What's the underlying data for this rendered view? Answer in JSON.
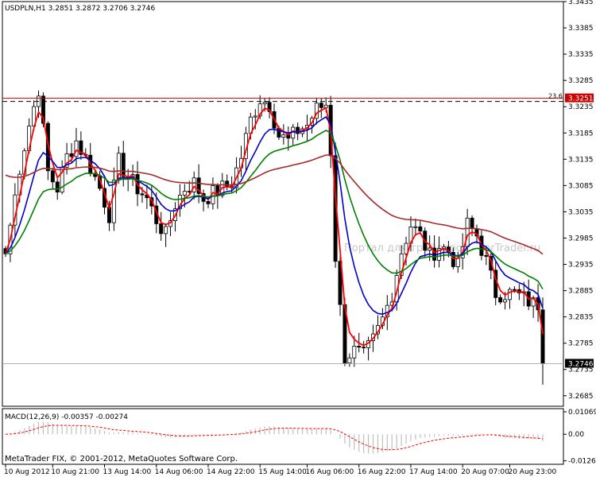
{
  "chart_data": [
    {
      "type": "candlestick",
      "title": "USDPLN,H1  3.2851 3.2872 3.2706 3.2746",
      "ylim": [
        3.2665,
        3.3435
      ],
      "y_ticks": [
        "3.3435",
        "3.3385",
        "3.3335",
        "3.3285",
        "3.3235",
        "3.3185",
        "3.3135",
        "3.3085",
        "3.3035",
        "3.2985",
        "3.2935",
        "3.2885",
        "3.2835",
        "3.2785",
        "3.2735",
        "3.2685"
      ],
      "x_ticks": [
        "10 Aug 2012",
        "10 Aug 21:00",
        "13 Aug 14:00",
        "14 Aug 06:00",
        "14 Aug 22:00",
        "15 Aug 14:00",
        "16 Aug 06:00",
        "16 Aug 22:00",
        "17 Aug 14:00",
        "20 Aug 07:00",
        "20 Aug 23:00"
      ],
      "x_tick_bar_index": [
        0,
        10,
        21,
        32,
        43,
        54,
        64,
        75,
        86,
        97,
        107
      ],
      "bar_count": 115,
      "current_price": 3.2746,
      "current_price_label": "3.2746",
      "fib_level": 3.3251,
      "fib_label": "23.6",
      "fib_price_label": "3.3251",
      "watermark": "Портал для трейдеров - ForTrader.ru",
      "close_anchors": [
        [
          0,
          3.2955
        ],
        [
          3,
          3.312
        ],
        [
          5,
          3.32
        ],
        [
          7,
          3.327
        ],
        [
          9,
          3.311
        ],
        [
          11,
          3.308
        ],
        [
          13,
          3.314
        ],
        [
          15,
          3.317
        ],
        [
          18,
          3.312
        ],
        [
          20,
          3.308
        ],
        [
          22,
          3.303
        ],
        [
          24,
          3.313
        ],
        [
          26,
          3.31
        ],
        [
          28,
          3.308
        ],
        [
          30,
          3.306
        ],
        [
          32,
          3.302
        ],
        [
          34,
          3.299
        ],
        [
          36,
          3.305
        ],
        [
          38,
          3.308
        ],
        [
          40,
          3.309
        ],
        [
          42,
          3.306
        ],
        [
          44,
          3.307
        ],
        [
          46,
          3.308
        ],
        [
          48,
          3.309
        ],
        [
          50,
          3.314
        ],
        [
          52,
          3.321
        ],
        [
          54,
          3.325
        ],
        [
          56,
          3.324
        ],
        [
          58,
          3.318
        ],
        [
          60,
          3.317
        ],
        [
          62,
          3.319
        ],
        [
          64,
          3.32
        ],
        [
          66,
          3.323
        ],
        [
          68,
          3.324
        ],
        [
          69,
          3.315
        ],
        [
          70,
          3.295
        ],
        [
          71,
          3.285
        ],
        [
          72,
          3.276
        ],
        [
          74,
          3.277
        ],
        [
          76,
          3.276
        ],
        [
          78,
          3.279
        ],
        [
          80,
          3.283
        ],
        [
          82,
          3.288
        ],
        [
          84,
          3.296
        ],
        [
          86,
          3.301
        ],
        [
          88,
          3.299
        ],
        [
          90,
          3.295
        ],
        [
          92,
          3.297
        ],
        [
          94,
          3.296
        ],
        [
          96,
          3.293
        ],
        [
          98,
          3.301
        ],
        [
          100,
          3.299
        ],
        [
          102,
          3.294
        ],
        [
          104,
          3.288
        ],
        [
          106,
          3.288
        ],
        [
          108,
          3.288
        ],
        [
          110,
          3.287
        ],
        [
          112,
          3.286
        ],
        [
          113,
          3.286
        ],
        [
          114,
          3.2746
        ]
      ],
      "indicators": [
        {
          "color": "#ff0000",
          "role": "fast moving average"
        },
        {
          "color": "#0000cc",
          "role": "medium moving average"
        },
        {
          "color": "#007f00",
          "role": "slow moving average"
        },
        {
          "color": "#a52a2a",
          "role": "long moving average"
        }
      ]
    },
    {
      "type": "macd",
      "title": "MACD(12,26,9) -0.00357 -0.00274",
      "ylim": [
        -0.0143,
        0.0122
      ],
      "y_ticks": [
        "0.01069",
        "0.00",
        "-0.01266"
      ],
      "histogram_color": "#c0c0c0",
      "signal_color": "#ff0000"
    }
  ],
  "footer": {
    "copyright": "MetaTrader FIX, © 2001-2012, MetaQuotes Software Corp."
  }
}
